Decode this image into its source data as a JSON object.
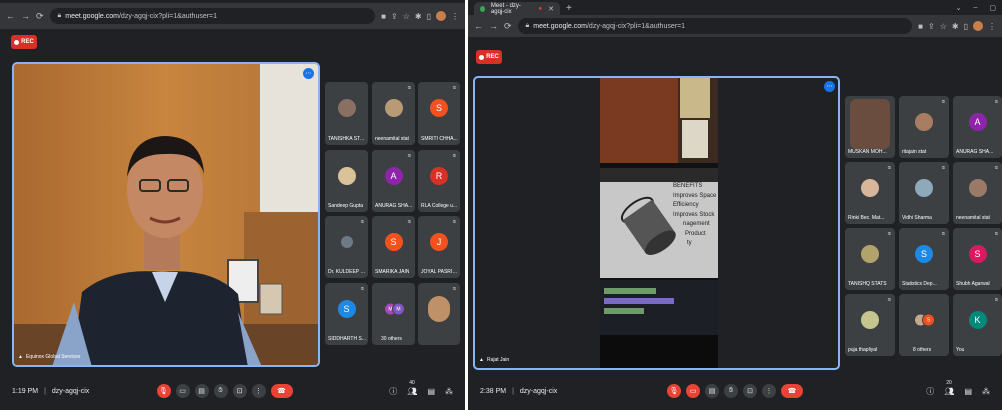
{
  "left": {
    "url_host": "meet.google.com",
    "url_path": "/dzy-agqj-cix?pli=1&authuser=1",
    "rec_label": "REC",
    "speaker_name": "Equinox Global Services",
    "time": "1:19 PM",
    "meeting_code": "dzy-agqj-cix",
    "people_count": "40",
    "tiles": [
      {
        "name": "TANISHKA STA..."
      },
      {
        "name": "neenamital stat"
      },
      {
        "name": "SMRITI CHHA...",
        "initial": "S",
        "color": "#f4511e"
      },
      {
        "name": "Sandeep Gupta"
      },
      {
        "name": "ANURAG SHA...",
        "initial": "A",
        "color": "#8e24aa"
      },
      {
        "name": "RLA College u...",
        "initial": "R",
        "color": "#d93025"
      },
      {
        "name": "Dr. KULDEEP S..."
      },
      {
        "name": "SMARIKA JAIN",
        "initial": "S",
        "color": "#f4511e"
      },
      {
        "name": "JOYAL PASRIC...",
        "initial": "J",
        "color": "#f4511e"
      },
      {
        "name": "SIDDHARTH S...",
        "initial": "S",
        "color": "#1e88e5"
      },
      {
        "name": "30 others",
        "a": "M",
        "b": "M"
      },
      {
        "name": ""
      }
    ]
  },
  "right": {
    "tab_title": "Meet - dzy-agqj-cix",
    "url_host": "meet.google.com",
    "url_path": "/dzy-agqj-cix?pli=1&authuser=1",
    "rec_label": "REC",
    "presenter_name": "Rajat Jain",
    "time": "2:38 PM",
    "meeting_code": "dzy-agqj-cix",
    "people_count": "20",
    "slide_lines": [
      "BENEFITS",
      "Improves Space",
      "Efficiency",
      "Improves Stock",
      "nagement",
      "Product",
      "ty"
    ],
    "tiles": [
      {
        "name": "MUSKAN MOH..."
      },
      {
        "name": "ritajain stat"
      },
      {
        "name": "ANURAG SHA...",
        "initial": "A",
        "color": "#8e24aa"
      },
      {
        "name": "Rinki Bec. Mat..."
      },
      {
        "name": "Vidhi Sharma"
      },
      {
        "name": "neenamital stat"
      },
      {
        "name": "TANISHQ STATS"
      },
      {
        "name": "Statistics Dep...",
        "initial": "S",
        "color": "#1e88e5"
      },
      {
        "name": "Shubh Agarwal",
        "initial": "S",
        "color": "#d81b60"
      },
      {
        "name": "puja thapliyal"
      },
      {
        "name": "8 others",
        "b": "S"
      },
      {
        "name": "You",
        "initial": "K",
        "color": "#00897b"
      }
    ]
  }
}
